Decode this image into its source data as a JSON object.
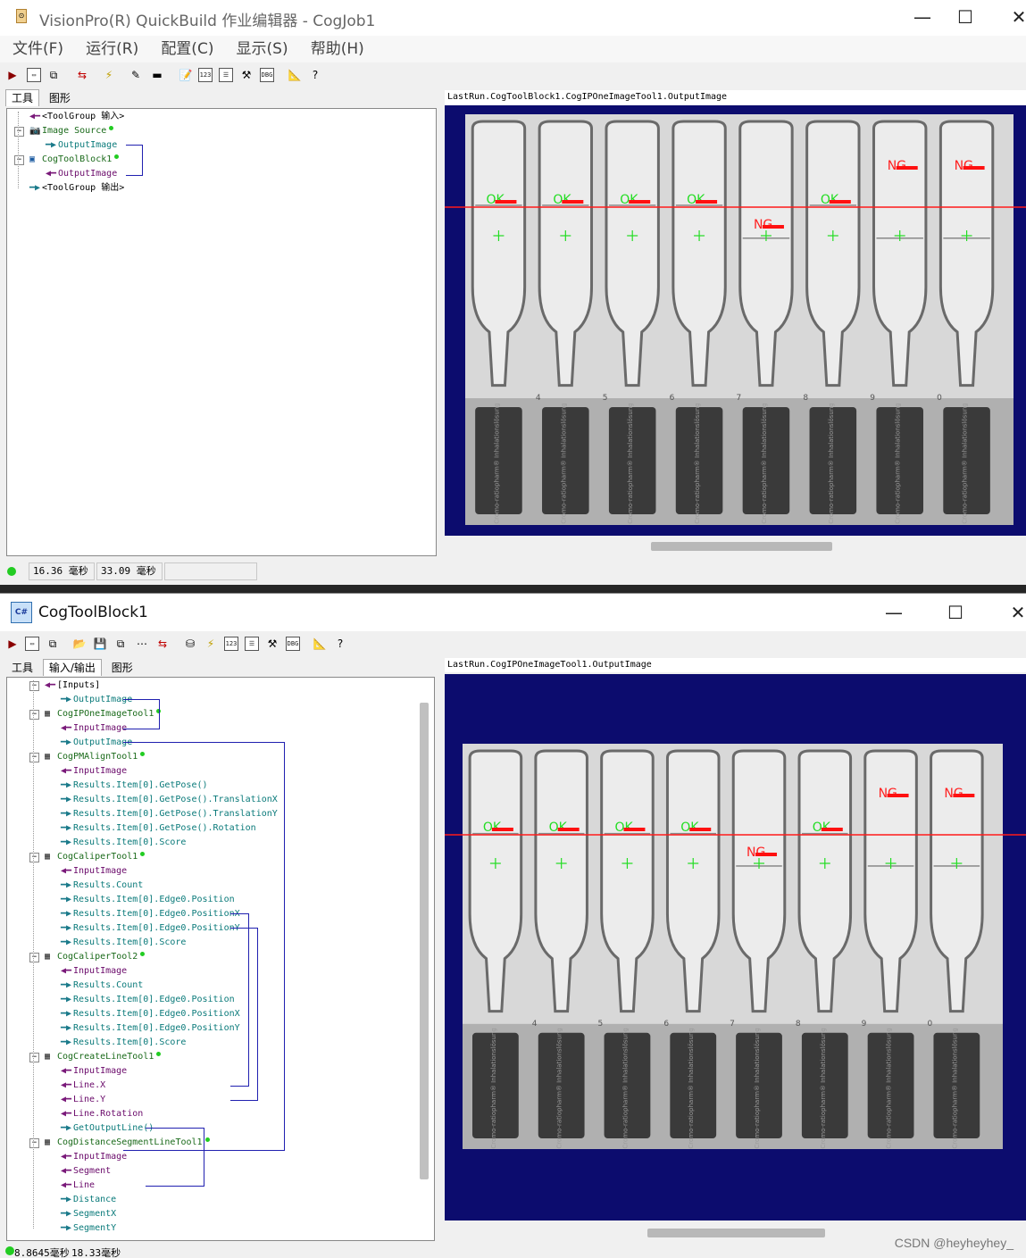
{
  "win1": {
    "title": "VisionPro(R) QuickBuild 作业编辑器 - CogJob1",
    "menu": [
      "文件(F)",
      "运行(R)",
      "配置(C)",
      "显示(S)",
      "帮助(H)"
    ],
    "tabs": [
      "工具",
      "图形"
    ],
    "tree": [
      {
        "label": "<ToolGroup 输入>",
        "kind": "in",
        "level": 0,
        "color": "black"
      },
      {
        "label": "Image Source",
        "kind": "camera",
        "level": 0,
        "color": "green",
        "dot": true
      },
      {
        "label": "OutputImage",
        "kind": "out",
        "level": 1,
        "color": "teal"
      },
      {
        "label": "CogToolBlock1",
        "kind": "block",
        "level": 0,
        "color": "green",
        "dot": true
      },
      {
        "label": "OutputImage",
        "kind": "in",
        "level": 1,
        "color": "purple"
      },
      {
        "label": "<ToolGroup 输出>",
        "kind": "out",
        "level": 0,
        "color": "black"
      }
    ],
    "image_title": "LastRun.CogToolBlock1.CogIPOneImageTool1.OutputImage",
    "status": [
      "16.36 毫秒",
      "33.09 毫秒"
    ]
  },
  "win2": {
    "title": "CogToolBlock1",
    "tabs": [
      "工具",
      "输入/输出",
      "图形"
    ],
    "tree": [
      {
        "label": "[Inputs]",
        "kind": "in",
        "level": 0,
        "color": "black"
      },
      {
        "label": "OutputImage",
        "kind": "out",
        "level": 1,
        "color": "teal"
      },
      {
        "label": "CogIPOneImageTool1",
        "kind": "tool",
        "level": 0,
        "color": "green",
        "dot": true
      },
      {
        "label": "InputImage",
        "kind": "in",
        "level": 1,
        "color": "purple"
      },
      {
        "label": "OutputImage",
        "kind": "out",
        "level": 1,
        "color": "teal"
      },
      {
        "label": "CogPMAlignTool1",
        "kind": "tool",
        "level": 0,
        "color": "green",
        "dot": true
      },
      {
        "label": "InputImage",
        "kind": "in",
        "level": 1,
        "color": "purple"
      },
      {
        "label": "Results.Item[0].GetPose()",
        "kind": "out",
        "level": 1,
        "color": "teal"
      },
      {
        "label": "Results.Item[0].GetPose().TranslationX",
        "kind": "out",
        "level": 1,
        "color": "teal"
      },
      {
        "label": "Results.Item[0].GetPose().TranslationY",
        "kind": "out",
        "level": 1,
        "color": "teal"
      },
      {
        "label": "Results.Item[0].GetPose().Rotation",
        "kind": "out",
        "level": 1,
        "color": "teal"
      },
      {
        "label": "Results.Item[0].Score",
        "kind": "out",
        "level": 1,
        "color": "teal"
      },
      {
        "label": "CogCaliperTool1",
        "kind": "tool",
        "level": 0,
        "color": "green",
        "dot": true
      },
      {
        "label": "InputImage",
        "kind": "in",
        "level": 1,
        "color": "purple"
      },
      {
        "label": "Results.Count",
        "kind": "out",
        "level": 1,
        "color": "teal"
      },
      {
        "label": "Results.Item[0].Edge0.Position",
        "kind": "out",
        "level": 1,
        "color": "teal"
      },
      {
        "label": "Results.Item[0].Edge0.PositionX",
        "kind": "out",
        "level": 1,
        "color": "teal"
      },
      {
        "label": "Results.Item[0].Edge0.PositionY",
        "kind": "out",
        "level": 1,
        "color": "teal"
      },
      {
        "label": "Results.Item[0].Score",
        "kind": "out",
        "level": 1,
        "color": "teal"
      },
      {
        "label": "CogCaliperTool2",
        "kind": "tool",
        "level": 0,
        "color": "green",
        "dot": true
      },
      {
        "label": "InputImage",
        "kind": "in",
        "level": 1,
        "color": "purple"
      },
      {
        "label": "Results.Count",
        "kind": "out",
        "level": 1,
        "color": "teal"
      },
      {
        "label": "Results.Item[0].Edge0.Position",
        "kind": "out",
        "level": 1,
        "color": "teal"
      },
      {
        "label": "Results.Item[0].Edge0.PositionX",
        "kind": "out",
        "level": 1,
        "color": "teal"
      },
      {
        "label": "Results.Item[0].Edge0.PositionY",
        "kind": "out",
        "level": 1,
        "color": "teal"
      },
      {
        "label": "Results.Item[0].Score",
        "kind": "out",
        "level": 1,
        "color": "teal"
      },
      {
        "label": "CogCreateLineTool1",
        "kind": "tool",
        "level": 0,
        "color": "green",
        "dot": true
      },
      {
        "label": "InputImage",
        "kind": "in",
        "level": 1,
        "color": "purple"
      },
      {
        "label": "Line.X",
        "kind": "in",
        "level": 1,
        "color": "purple"
      },
      {
        "label": "Line.Y",
        "kind": "in",
        "level": 1,
        "color": "purple"
      },
      {
        "label": "Line.Rotation",
        "kind": "in",
        "level": 1,
        "color": "purple"
      },
      {
        "label": "GetOutputLine()",
        "kind": "out",
        "level": 1,
        "color": "teal"
      },
      {
        "label": "CogDistanceSegmentLineTool1",
        "kind": "tool",
        "level": 0,
        "color": "green",
        "dot": true
      },
      {
        "label": "InputImage",
        "kind": "in",
        "level": 1,
        "color": "purple"
      },
      {
        "label": "Segment",
        "kind": "in",
        "level": 1,
        "color": "purple"
      },
      {
        "label": "Line",
        "kind": "in",
        "level": 1,
        "color": "purple"
      },
      {
        "label": "Distance",
        "kind": "out",
        "level": 1,
        "color": "teal"
      },
      {
        "label": "SegmentX",
        "kind": "out",
        "level": 1,
        "color": "teal"
      },
      {
        "label": "SegmentY",
        "kind": "out",
        "level": 1,
        "color": "teal"
      }
    ],
    "image_title": "LastRun.CogIPOneImageTool1.OutputImage",
    "status": [
      "8.8645毫秒",
      "18.33毫秒"
    ]
  },
  "vials": [
    {
      "result": "OK"
    },
    {
      "result": "OK"
    },
    {
      "result": "OK"
    },
    {
      "result": "OK"
    },
    {
      "result": "NG"
    },
    {
      "result": "OK"
    },
    {
      "result": "NG"
    },
    {
      "result": "NG"
    }
  ],
  "vial_numbers": [
    "4",
    "5",
    "6",
    "7",
    "8",
    "9",
    "0"
  ],
  "vial_label": "Cromo-ratiopharm® Inhalationslösung",
  "watermark": "CSDN @heyheyhey_",
  "colors": {
    "ok": "#22dd22",
    "ng": "#ff2020",
    "link": "#2020b0",
    "panel_bg": "#0c0c6e"
  }
}
